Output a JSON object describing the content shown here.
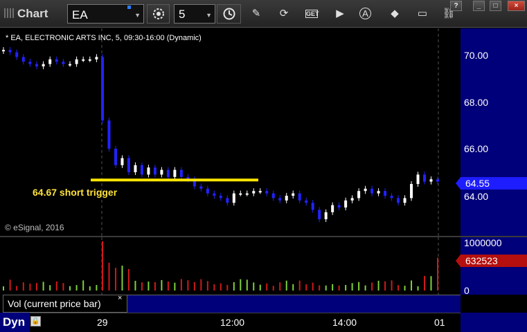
{
  "app": {
    "title": "Chart"
  },
  "toolbar": {
    "symbol": "EA",
    "interval": "5",
    "icons": [
      "cursor-gear-icon",
      "clock-icon",
      "pencil-icon",
      "refresh-icon",
      "get-icon",
      "play-icon",
      "alert-icon",
      "eraser-icon",
      "comment-icon",
      "link-icon"
    ]
  },
  "window_buttons": {
    "help": "?",
    "minimize": "_",
    "maximize": "□",
    "close": "×"
  },
  "chart": {
    "caption": "* EA, ELECTRONIC ARTS INC, 5, 09:30-16:00 (Dynamic)",
    "copyright": "© eSignal, 2016",
    "annotation": "64.67 short trigger",
    "price_ticks": [
      "70.00",
      "68.00",
      "66.00",
      "64.00"
    ],
    "last_price": "64.55",
    "volume_ticks": [
      "1000000",
      "0"
    ],
    "last_volume": "632523",
    "volume_study_label": "Vol (current price bar)",
    "volume_study_close": "×",
    "time_ticks": [
      "29",
      "12:00",
      "14:00",
      "01"
    ],
    "mode_label": "Dyn",
    "colors": {
      "up_bar": "#ffffff",
      "down_bar": "#2222ff",
      "trigger_line": "#ffe600",
      "vol_up": "#7fd13b",
      "vol_down": "#d01919",
      "axis_panel": "#00007a"
    }
  },
  "chart_data": {
    "type": "candlestick",
    "price_axis": [
      63,
      71
    ],
    "trigger_level": 64.67,
    "last_price": 64.55,
    "close_path": [
      70.2,
      70.1,
      69.9,
      69.7,
      69.6,
      69.5,
      69.6,
      69.8,
      69.7,
      69.6,
      69.6,
      69.8,
      69.8,
      69.8,
      69.9,
      67.2,
      66.0,
      65.3,
      65.6,
      65.0,
      65.3,
      64.9,
      65.2,
      64.9,
      65.1,
      64.8,
      65.1,
      64.8,
      64.7,
      64.4,
      64.3,
      64.1,
      64.0,
      63.9,
      63.7,
      64.1,
      64.1,
      64.1,
      64.2,
      64.2,
      64.1,
      63.9,
      63.8,
      64.0,
      64.1,
      63.8,
      63.7,
      63.4,
      63.0,
      63.3,
      63.6,
      63.5,
      63.8,
      63.9,
      64.2,
      64.3,
      64.1,
      64.2,
      64.0,
      63.9,
      63.7,
      63.9,
      64.5,
      64.9,
      64.6,
      64.7,
      64.6
    ],
    "volume_axis": [
      0,
      1000000
    ],
    "last_volume": 632523
  }
}
